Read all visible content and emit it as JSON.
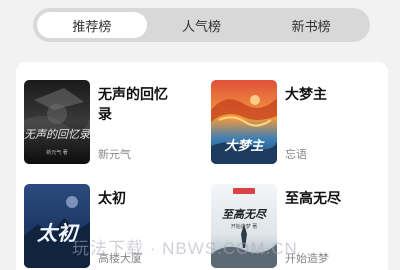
{
  "tabs": [
    {
      "label": "推荐榜",
      "active": true
    },
    {
      "label": "人气榜",
      "active": false
    },
    {
      "label": "新书榜",
      "active": false
    }
  ],
  "books": [
    {
      "title": "无声的回忆录",
      "author": "新元气",
      "cover_text": "无声的回忆录",
      "cover_subtext": "新元气 著"
    },
    {
      "title": "大梦主",
      "author": "忘语",
      "cover_text": "大梦主",
      "cover_subtext": ""
    },
    {
      "title": "太初",
      "author": "高楼大厦",
      "cover_text": "太初",
      "cover_subtext": ""
    },
    {
      "title": "至高无尽",
      "author": "开始造梦",
      "cover_text": "至高无尽",
      "cover_subtext": "开始造梦 著"
    }
  ],
  "watermark": "玩法下载 · NBWS.COM.CN",
  "colors": {
    "page_bg": "#f2f2f2",
    "tab_track": "#d8d8d8",
    "tab_active": "#ffffff",
    "card_bg": "#ffffff"
  }
}
